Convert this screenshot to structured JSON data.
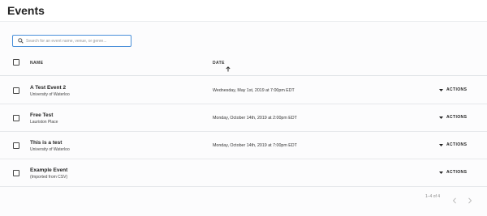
{
  "header": {
    "title": "Events"
  },
  "search": {
    "placeholder": "Search for an event name, venue, or genre...",
    "value": "",
    "icon": "search-icon"
  },
  "table": {
    "columns": {
      "name": "NAME",
      "date": "DATE",
      "sort_icon": "arrow-up-icon"
    },
    "rows": [
      {
        "name": "A Test Event 2",
        "venue": "University of Waterloo",
        "date": "Wednesday, May 1st, 2019 at 7:00pm EDT",
        "action_label": "ACTIONS"
      },
      {
        "name": "Free Test",
        "venue": "Lauriston Place",
        "date": "Monday, October 14th, 2019 at 2:00pm EDT",
        "action_label": "ACTIONS"
      },
      {
        "name": "This is a test",
        "venue": "University of Waterloo",
        "date": "Monday, October 14th, 2019 at 7:00pm EDT",
        "action_label": "ACTIONS"
      },
      {
        "name": "Example Event",
        "venue": "(Imported from CSV)",
        "date": "",
        "action_label": "ACTIONS"
      }
    ]
  },
  "pagination": {
    "range": "1–4 of 4",
    "prev_icon": "chevron-left-icon",
    "next_icon": "chevron-right-icon"
  },
  "colors": {
    "accent": "#4a90d9",
    "divider": "#e6e8eb"
  }
}
